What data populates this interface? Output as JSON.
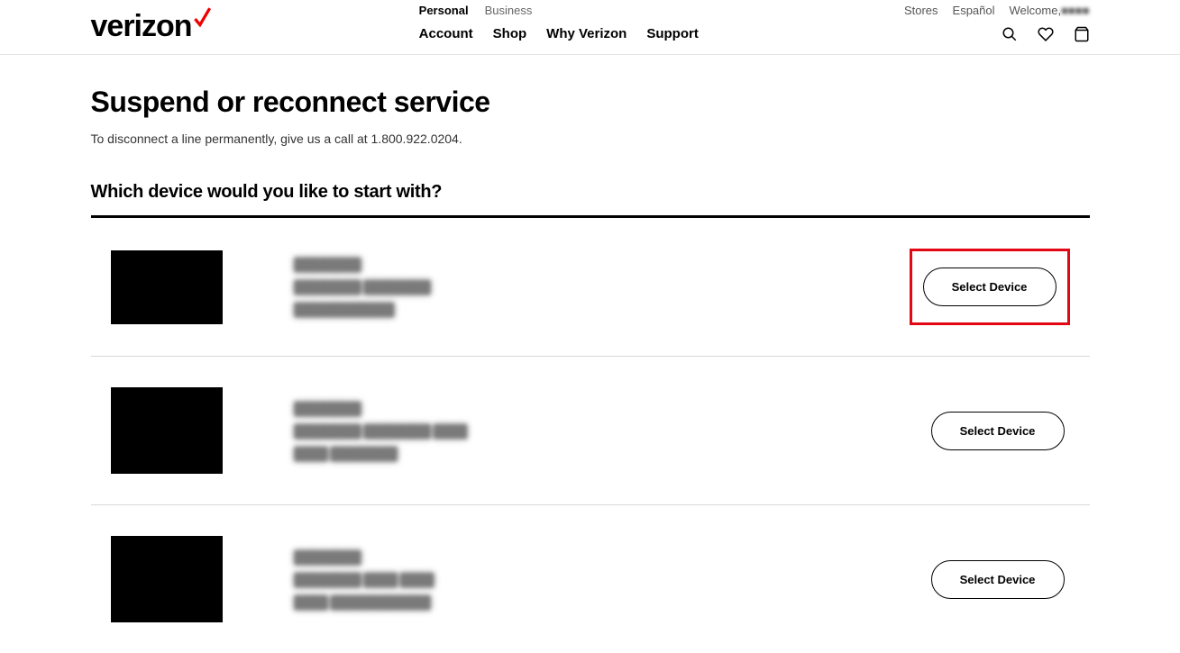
{
  "header": {
    "logo_text": "verizon",
    "top_tabs": {
      "personal": "Personal",
      "business": "Business"
    },
    "main_nav": {
      "account": "Account",
      "shop": "Shop",
      "why": "Why Verizon",
      "support": "Support"
    },
    "top_links": {
      "stores": "Stores",
      "espanol": "Español",
      "welcome_prefix": "Welcome,",
      "welcome_name": "■■■■"
    }
  },
  "page": {
    "title": "Suspend or reconnect service",
    "subtitle": "To disconnect a line permanently, give us a call at 1.800.922.0204.",
    "question": "Which device would you like to start with?"
  },
  "devices": [
    {
      "line1": "████████",
      "line2": "████████ ████████",
      "line3": "████████████",
      "button": "Select Device",
      "highlighted": true
    },
    {
      "line1": "████████",
      "line2": "████████ ████████ ████",
      "line3": "████ ████████",
      "button": "Select Device",
      "highlighted": false
    },
    {
      "line1": "████████",
      "line2": "████████ ████ ████",
      "line3": "████ ████████████",
      "button": "Select Device",
      "highlighted": false
    }
  ]
}
